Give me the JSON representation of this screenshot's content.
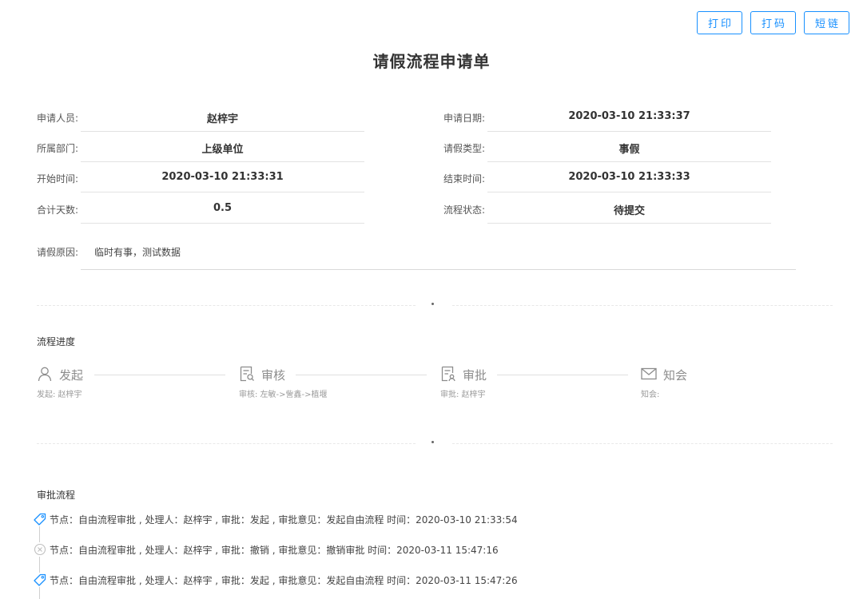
{
  "toolbar": {
    "print": "打印",
    "code": "打码",
    "short_link": "短链"
  },
  "title": "请假流程申请单",
  "fields": {
    "applicant": {
      "label": "申请人员:",
      "value": "赵梓宇"
    },
    "apply_date": {
      "label": "申请日期:",
      "value": "2020-03-10 21:33:37"
    },
    "department": {
      "label": "所属部门:",
      "value": "上级单位"
    },
    "leave_type": {
      "label": "请假类型:",
      "value": "事假"
    },
    "start_time": {
      "label": "开始时间:",
      "value": "2020-03-10 21:33:31"
    },
    "end_time": {
      "label": "结束时间:",
      "value": "2020-03-10 21:33:33"
    },
    "total_days": {
      "label": "合计天数:",
      "value": "0.5"
    },
    "flow_status": {
      "label": "流程状态:",
      "value": "待提交"
    }
  },
  "reason": {
    "label": "请假原因:",
    "value": "临时有事，测试数据"
  },
  "progress": {
    "title": "流程进度",
    "steps": [
      {
        "name": "发起",
        "desc": "发起: 赵梓宇",
        "icon": "user-icon"
      },
      {
        "name": "审核",
        "desc": "审核: 左敏->訾鑫->植堰",
        "icon": "document-review-icon"
      },
      {
        "name": "审批",
        "desc": "审批: 赵梓宇",
        "icon": "document-approve-icon"
      },
      {
        "name": "知会",
        "desc": "知会:",
        "icon": "mail-icon"
      }
    ]
  },
  "approval": {
    "title": "审批流程",
    "entries": [
      {
        "text": "节点：自由流程审批 , 处理人：赵梓宇 , 审批：发起 , 审批意见：发起自由流程 时间：2020-03-10 21:33:54",
        "icon": "tag-icon",
        "color": "#1890ff"
      },
      {
        "text": "节点：自由流程审批 , 处理人：赵梓宇 , 审批：撤销 , 审批意见：撤销审批 时间：2020-03-11 15:47:16",
        "icon": "close-circle-icon",
        "color": "#bfbfbf"
      },
      {
        "text": "节点：自由流程审批 , 处理人：赵梓宇 , 审批：发起 , 审批意见：发起自由流程 时间：2020-03-11 15:47:26",
        "icon": "tag-icon",
        "color": "#1890ff"
      }
    ]
  }
}
